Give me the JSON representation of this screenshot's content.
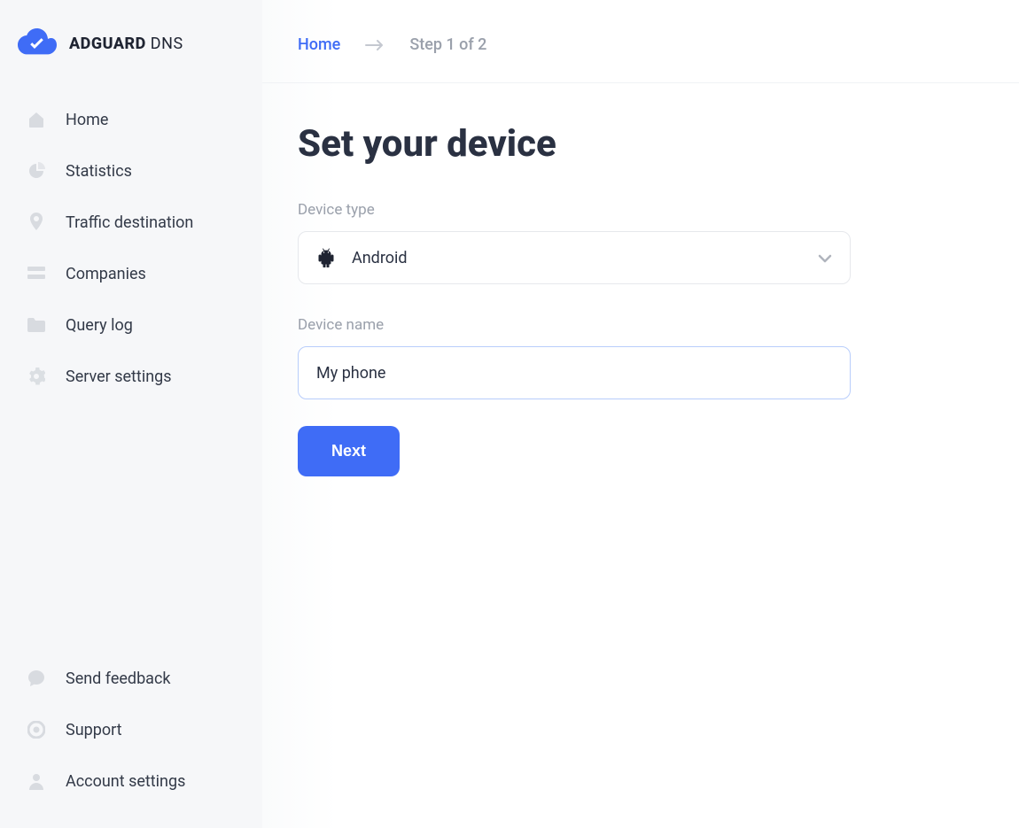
{
  "brand": {
    "name_bold": "ADGUARD",
    "name_thin": " DNS"
  },
  "sidebar": {
    "nav_top": [
      {
        "label": "Home",
        "icon": "home"
      },
      {
        "label": "Statistics",
        "icon": "pie"
      },
      {
        "label": "Traffic destination",
        "icon": "pin"
      },
      {
        "label": "Companies",
        "icon": "list"
      },
      {
        "label": "Query log",
        "icon": "folder"
      },
      {
        "label": "Server settings",
        "icon": "gear"
      }
    ],
    "nav_bottom": [
      {
        "label": "Send feedback",
        "icon": "chat"
      },
      {
        "label": "Support",
        "icon": "target"
      },
      {
        "label": "Account settings",
        "icon": "user"
      }
    ]
  },
  "breadcrumb": {
    "home_label": "Home",
    "step_label": "Step 1 of 2"
  },
  "form": {
    "title": "Set your device",
    "device_type_label": "Device type",
    "device_type_value": "Android",
    "device_name_label": "Device name",
    "device_name_value": "My phone",
    "next_label": "Next"
  }
}
